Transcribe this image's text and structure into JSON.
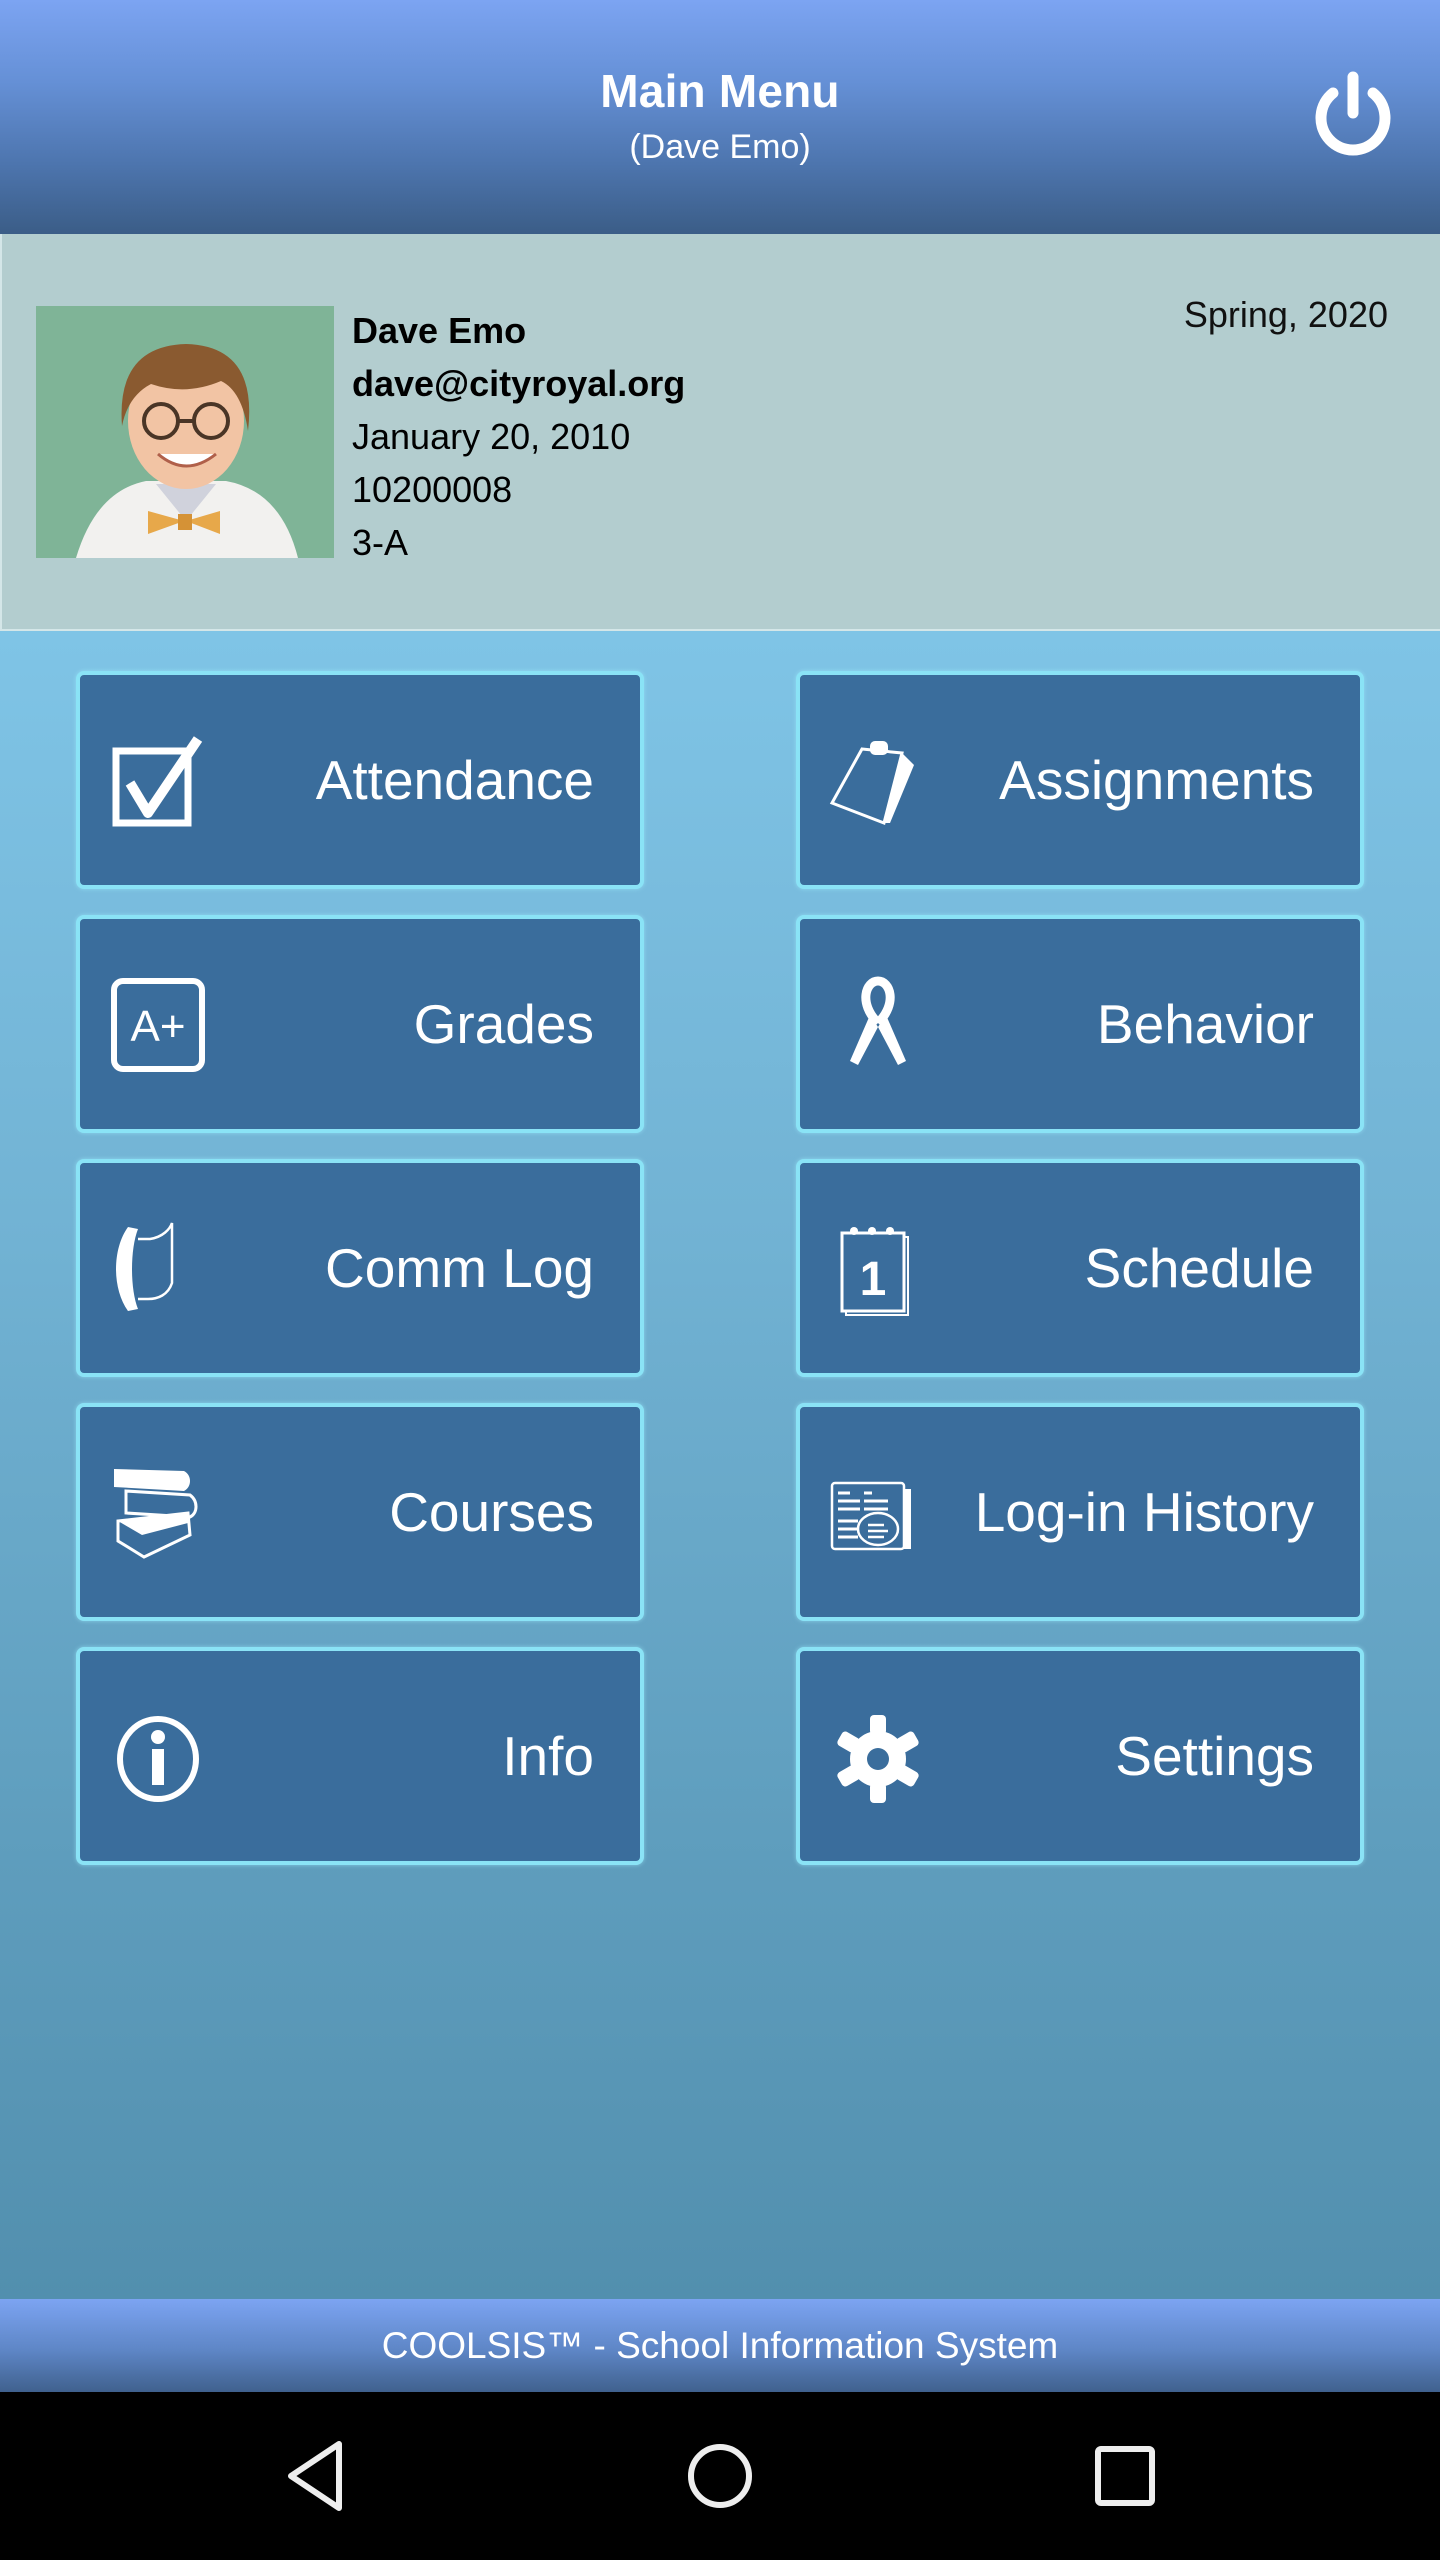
{
  "header": {
    "title": "Main Menu",
    "subtitle": "(Dave Emo)",
    "power_icon": "power-icon"
  },
  "profile": {
    "photo_alt": "Student photo",
    "name": "Dave Emo",
    "email": "dave@cityroyal.org",
    "birthdate": "January 20, 2010",
    "student_id": "10200008",
    "class": "3-A",
    "term": "Spring, 2020"
  },
  "menu": {
    "items": [
      {
        "label": "Attendance",
        "icon": "checkbox-icon"
      },
      {
        "label": "Assignments",
        "icon": "clipboard-icon"
      },
      {
        "label": "Grades",
        "icon": "grade-a-plus-icon"
      },
      {
        "label": "Behavior",
        "icon": "ribbon-icon"
      },
      {
        "label": "Comm Log",
        "icon": "phone-log-icon"
      },
      {
        "label": "Schedule",
        "icon": "calendar-icon"
      },
      {
        "label": "Courses",
        "icon": "books-icon"
      },
      {
        "label": "Log-in History",
        "icon": "document-search-icon"
      },
      {
        "label": "Info",
        "icon": "info-icon"
      },
      {
        "label": "Settings",
        "icon": "gear-icon"
      }
    ]
  },
  "footer": {
    "text": "COOLSIS™ - School Information System"
  },
  "navbar": {
    "back": "back-icon",
    "home": "home-icon",
    "recents": "recents-icon"
  },
  "colors": {
    "header_top": "#7ca4f2",
    "header_bottom": "#3b5d87",
    "profile_bg": "#b3cdcf",
    "button_bg": "#3a6d9c",
    "button_border": "#8ae3f6",
    "main_top": "#7fc4e6",
    "main_bottom": "#528fae"
  }
}
